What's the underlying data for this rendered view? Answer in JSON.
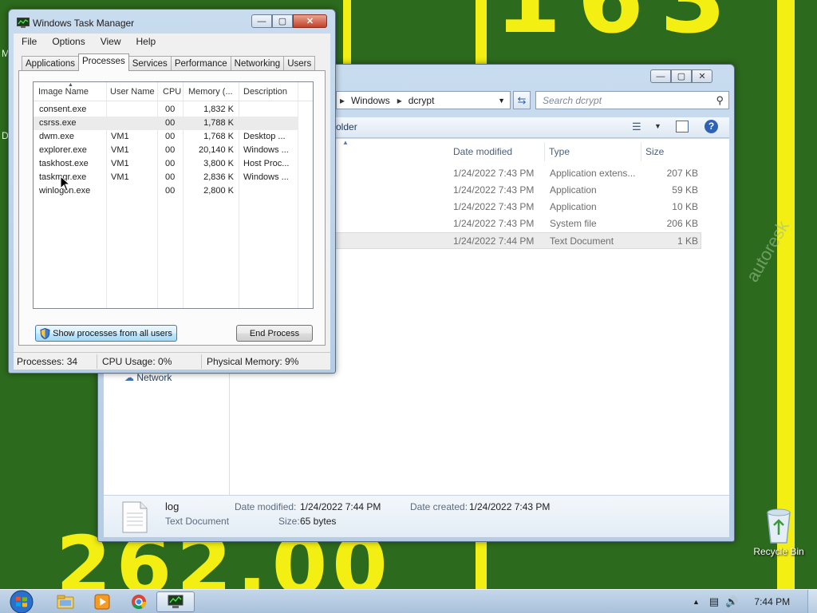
{
  "wallpaper": {
    "top_number": "163",
    "bottom_number": "262.00",
    "edge_letters": [
      "M",
      "D"
    ],
    "watermark": "autoresk"
  },
  "desktop_icons": [
    {
      "label": "Recycle Bin",
      "icon": "recycle-bin-icon"
    }
  ],
  "explorer": {
    "breadcrumb": [
      "Windows",
      "dcrypt"
    ],
    "search_placeholder": "Search dcrypt",
    "toolbar": {
      "folder_label": "older"
    },
    "columns": [
      "Date modified",
      "Type",
      "Size"
    ],
    "files": [
      {
        "date": "1/24/2022 7:43 PM",
        "type": "Application extens...",
        "size": "207 KB"
      },
      {
        "date": "1/24/2022 7:43 PM",
        "type": "Application",
        "size": "59 KB"
      },
      {
        "date": "1/24/2022 7:43 PM",
        "type": "Application",
        "size": "10 KB"
      },
      {
        "date": "1/24/2022 7:43 PM",
        "type": "System file",
        "size": "206 KB"
      },
      {
        "date": "1/24/2022 7:44 PM",
        "type": "Text Document",
        "size": "1 KB"
      }
    ],
    "nav_network": "Network",
    "details": {
      "name": "log",
      "type": "Text Document",
      "date_modified_label": "Date modified:",
      "date_modified": "1/24/2022 7:44 PM",
      "date_created_label": "Date created:",
      "date_created": "1/24/2022 7:43 PM",
      "size_label": "Size:",
      "size": "65 bytes"
    }
  },
  "taskmgr": {
    "title": "Windows Task Manager",
    "menu": [
      "File",
      "Options",
      "View",
      "Help"
    ],
    "tabs": [
      "Applications",
      "Processes",
      "Services",
      "Performance",
      "Networking",
      "Users"
    ],
    "active_tab": "Processes",
    "columns": [
      "Image Name",
      "User Name",
      "CPU",
      "Memory (...",
      "Description"
    ],
    "processes": [
      {
        "image": "consent.exe",
        "user": "",
        "cpu": "00",
        "memory": "1,832 K",
        "desc": ""
      },
      {
        "image": "csrss.exe",
        "user": "",
        "cpu": "00",
        "memory": "1,788 K",
        "desc": ""
      },
      {
        "image": "dwm.exe",
        "user": "VM1",
        "cpu": "00",
        "memory": "1,768 K",
        "desc": "Desktop ..."
      },
      {
        "image": "explorer.exe",
        "user": "VM1",
        "cpu": "00",
        "memory": "20,140 K",
        "desc": "Windows ..."
      },
      {
        "image": "taskhost.exe",
        "user": "VM1",
        "cpu": "00",
        "memory": "3,800 K",
        "desc": "Host Proc..."
      },
      {
        "image": "taskmgr.exe",
        "user": "VM1",
        "cpu": "00",
        "memory": "2,836 K",
        "desc": "Windows ..."
      },
      {
        "image": "winlogon.exe",
        "user": "",
        "cpu": "00",
        "memory": "2,800 K",
        "desc": ""
      }
    ],
    "show_all_button": "Show processes from all users",
    "end_process_button": "End Process",
    "status": {
      "processes": "Processes: 34",
      "cpu": "CPU Usage: 0%",
      "memory": "Physical Memory: 9%"
    }
  },
  "taskbar": {
    "clock": "7:44 PM",
    "items": [
      "windows-explorer-icon",
      "media-player-icon",
      "chrome-icon",
      "task-manager-icon"
    ]
  }
}
